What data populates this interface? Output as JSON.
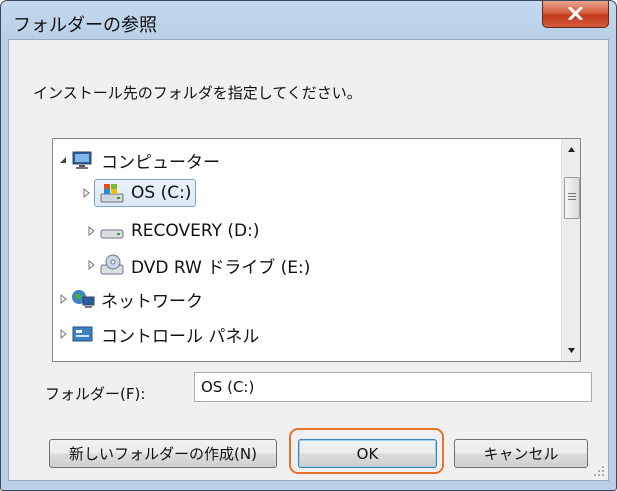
{
  "window": {
    "title": "フォルダーの参照"
  },
  "instruction": "インストール先のフォルダを指定してください。",
  "tree": {
    "items": [
      {
        "label": "コンピューター",
        "icon": "computer-icon",
        "expanded": true
      },
      {
        "label": "OS (C:)",
        "icon": "windows-drive-icon",
        "selected": true
      },
      {
        "label": "RECOVERY (D:)",
        "icon": "hard-drive-icon"
      },
      {
        "label": "DVD RW ドライブ (E:)",
        "icon": "dvd-drive-icon"
      },
      {
        "label": "ネットワーク",
        "icon": "network-icon"
      },
      {
        "label": "コントロール パネル",
        "icon": "control-panel-icon"
      }
    ]
  },
  "folder": {
    "label": "フォルダー(F):",
    "value": "OS (C:)"
  },
  "buttons": {
    "new_folder": "新しいフォルダーの作成(N)",
    "ok": "OK",
    "cancel": "キャンセル"
  },
  "colors": {
    "highlight": "#e8722a",
    "selection_border": "#7da2ce",
    "close_button": "#c8432a"
  }
}
